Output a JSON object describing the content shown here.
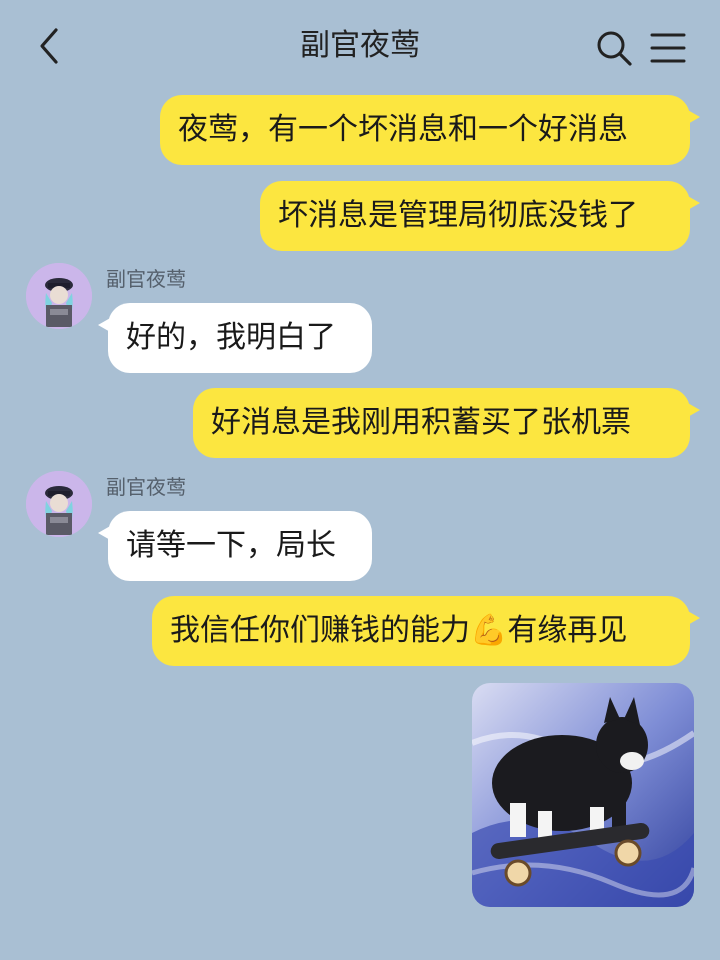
{
  "header": {
    "title": "副官夜莺",
    "back_icon": "chevron-left-icon",
    "search_icon": "search-icon",
    "menu_icon": "menu-icon"
  },
  "messages": [
    {
      "from": "me",
      "text": "夜莺，有一个坏消息和一个好消息"
    },
    {
      "from": "me",
      "text": "坏消息是管理局彻底没钱了"
    },
    {
      "from": "them",
      "sender": "副官夜莺",
      "text": "好的，我明白了"
    },
    {
      "from": "me",
      "text": "好消息是我刚用积蓄买了张机票"
    },
    {
      "from": "them",
      "sender": "副官夜莺",
      "text": "请等一下，局长"
    },
    {
      "from": "me",
      "text": "我信任你们赚钱的能力💪有缘再见"
    },
    {
      "from": "me",
      "type": "sticker",
      "sticker": "cat-on-skateboard-sticker"
    }
  ],
  "colors": {
    "background": "#a9bfd3",
    "my_bubble": "#fce640",
    "their_bubble": "#ffffff"
  }
}
